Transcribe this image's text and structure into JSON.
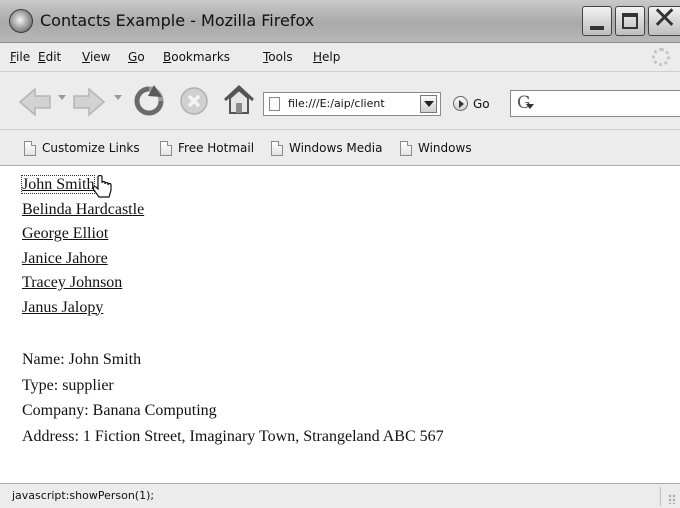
{
  "window": {
    "title": "Contacts Example - Mozilla Firefox"
  },
  "menu": {
    "items": [
      {
        "accel": "F",
        "rest": "ile"
      },
      {
        "accel": "E",
        "rest": "dit"
      },
      {
        "accel": "V",
        "rest": "iew"
      },
      {
        "accel": "G",
        "rest": "o"
      },
      {
        "accel": "B",
        "rest": "ookmarks"
      },
      {
        "accel": "T",
        "rest": "ools"
      },
      {
        "accel": "H",
        "rest": "elp"
      }
    ]
  },
  "navbar": {
    "url": "file:///E:/aip/client",
    "go_label": "Go",
    "search_icon": "google-g-icon"
  },
  "bookmarks": {
    "items": [
      "Customize Links",
      "Free Hotmail",
      "Windows Media",
      "Windows"
    ]
  },
  "content": {
    "contacts": [
      "John Smith",
      "Belinda Hardcastle",
      "George Elliot",
      "Janice Jahore",
      "Tracey Johnson",
      "Janus Jalopy"
    ],
    "details": {
      "name": "Name: John Smith",
      "type": "Type: supplier",
      "company": "Company: Banana Computing",
      "address": "Address: 1 Fiction Street, Imaginary Town, Strangeland ABC 567"
    }
  },
  "status": {
    "text": "javascript:showPerson(1);"
  }
}
